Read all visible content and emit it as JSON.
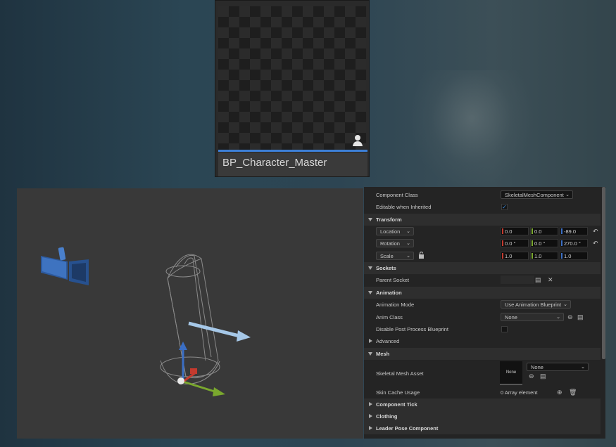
{
  "asset": {
    "name": "BP_Character_Master",
    "type_icon": "skeletal-mesh-person-icon"
  },
  "details": {
    "component_class": {
      "label": "Component Class",
      "value": "SkeletalMeshComponent"
    },
    "editable_when_inherited": {
      "label": "Editable when Inherited",
      "checked": true
    },
    "transform": {
      "title": "Transform",
      "location": {
        "mode": "Location",
        "x": "0.0",
        "y": "0.0",
        "z": "-89.0"
      },
      "rotation": {
        "mode": "Rotation",
        "x": "0.0 °",
        "y": "0.0 °",
        "z": "270.0 °"
      },
      "scale": {
        "mode": "Scale",
        "x": "1.0",
        "y": "1.0",
        "z": "1.0"
      }
    },
    "sockets": {
      "title": "Sockets",
      "parent_socket": {
        "label": "Parent Socket"
      }
    },
    "animation": {
      "title": "Animation",
      "mode": {
        "label": "Animation Mode",
        "value": "Use Animation Blueprint"
      },
      "anim_class": {
        "label": "Anim Class",
        "value": "None"
      },
      "disable_post_process": {
        "label": "Disable Post Process Blueprint",
        "checked": false
      },
      "advanced": "Advanced"
    },
    "mesh": {
      "title": "Mesh",
      "skeletal_mesh_asset": {
        "label": "Skeletal Mesh Asset",
        "thumb": "None",
        "value": "None"
      },
      "skin_cache_usage": {
        "label": "Skin Cache Usage",
        "value": "0 Array element"
      }
    },
    "collapsed_sections": [
      "Component Tick",
      "Clothing",
      "Leader Pose Component"
    ]
  },
  "colors": {
    "accent": "#3d7fd6",
    "x_axis": "#c43a2e",
    "y_axis": "#7aa82e",
    "z_axis": "#3a6ec4",
    "checkbox": "#3d8ee0"
  }
}
